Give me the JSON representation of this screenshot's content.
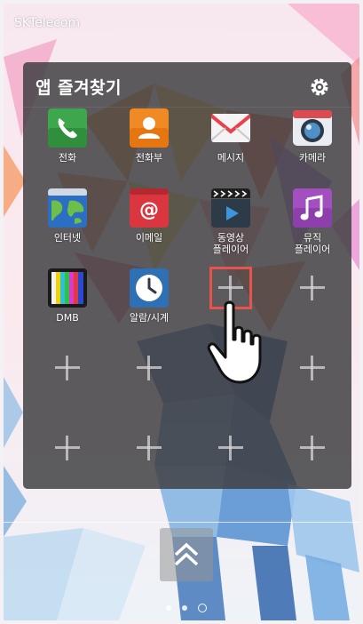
{
  "status_bar": {
    "carrier": "SKTelecom"
  },
  "panel": {
    "title": "앱 즐겨찾기",
    "apps": [
      {
        "label": "전화",
        "icon": "phone-icon"
      },
      {
        "label": "전화부",
        "icon": "contacts-icon"
      },
      {
        "label": "메시지",
        "icon": "message-icon"
      },
      {
        "label": "카메라",
        "icon": "camera-icon"
      },
      {
        "label": "인터넷",
        "icon": "internet-icon"
      },
      {
        "label": "이메일",
        "icon": "email-icon"
      },
      {
        "label": "동영상\n플레이어",
        "icon": "video-player-icon"
      },
      {
        "label": "뮤직\n플레이어",
        "icon": "music-player-icon"
      },
      {
        "label": "DMB",
        "icon": "dmb-icon"
      },
      {
        "label": "알람/시계",
        "icon": "alarm-clock-icon"
      }
    ],
    "empty_slots": 10
  },
  "colors": {
    "highlight": "#e7534d",
    "panel_bg": "#3e3e40"
  }
}
